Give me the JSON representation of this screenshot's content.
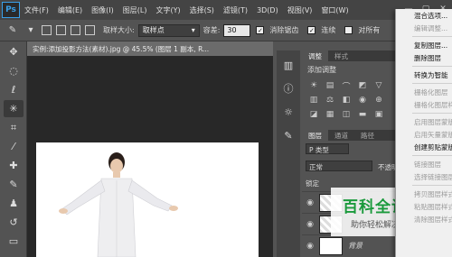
{
  "app": {
    "logo": "Ps"
  },
  "menu": [
    "文件(F)",
    "编辑(E)",
    "图像(I)",
    "图层(L)",
    "文字(Y)",
    "选择(S)",
    "滤镜(T)",
    "3D(D)",
    "视图(V)",
    "窗口(W)"
  ],
  "options": {
    "sample_size_label": "取样大小:",
    "sample_size_value": "取样点",
    "tolerance_label": "容差:",
    "tolerance_value": "30",
    "antialias_label": "消除锯齿",
    "contiguous_label": "连续",
    "all_layers_label": "对所有"
  },
  "document": {
    "tab_title": "实例:添加投影方法(素材).jpg @ 45.5% (图层 1 副本, R..."
  },
  "panels": {
    "tabs": [
      "调整",
      "样式"
    ],
    "adjust_title": "添加调整",
    "layer_tabs": [
      "图层",
      "通道",
      "路径"
    ],
    "filter_label": "P 类型",
    "blend_mode": "正常",
    "opacity_label": "不透明度",
    "lock_label": "锁定",
    "layers": [
      {
        "name": ""
      },
      {
        "name": ""
      },
      {
        "name": "背景"
      }
    ]
  },
  "context_menu": [
    {
      "label": "混合选项...",
      "enabled": true
    },
    {
      "label": "编辑调整...",
      "enabled": false
    },
    {
      "sep": true
    },
    {
      "label": "复制图层...",
      "enabled": true
    },
    {
      "label": "删除图层",
      "enabled": true
    },
    {
      "sep": true
    },
    {
      "label": "转换为智能",
      "enabled": true
    },
    {
      "sep": true
    },
    {
      "label": "栅格化图层",
      "enabled": false
    },
    {
      "label": "栅格化图层样式",
      "enabled": false
    },
    {
      "sep": true
    },
    {
      "label": "启用图层蒙版",
      "enabled": false
    },
    {
      "label": "启用矢量蒙版",
      "enabled": false
    },
    {
      "label": "创建剪贴蒙版",
      "enabled": true
    },
    {
      "sep": true
    },
    {
      "label": "链接图层",
      "enabled": false
    },
    {
      "label": "选择链接图层",
      "enabled": false
    },
    {
      "sep": true
    },
    {
      "label": "拷贝图层样式",
      "enabled": false
    },
    {
      "label": "粘贴图层样式",
      "enabled": false
    },
    {
      "label": "清除图层样式",
      "enabled": false
    }
  ],
  "watermark": {
    "title": "百科全说",
    "subtitle": "助你轻松解决"
  }
}
